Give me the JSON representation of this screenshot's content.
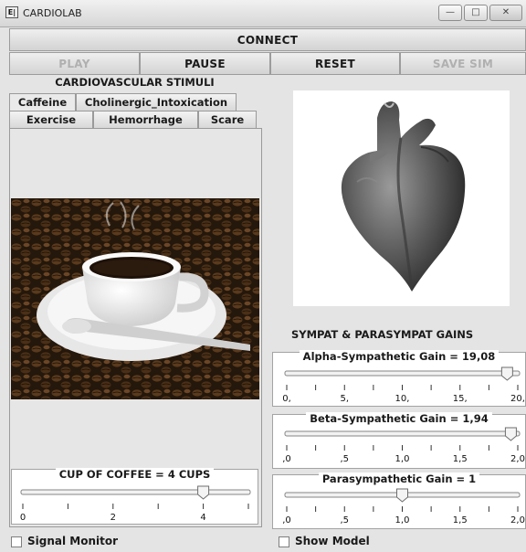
{
  "window": {
    "title": "CARDIOLAB",
    "icon_text": "E|"
  },
  "toolbar": {
    "connect": "CONNECT",
    "play": "PLAY",
    "pause": "PAUSE",
    "reset": "RESET",
    "save_sim": "SAVE SIM"
  },
  "stimuli": {
    "title": "CARDIOVASCULAR STIMULI",
    "tabs": [
      "Caffeine",
      "Cholinergic_Intoxication",
      "Exercise",
      "Hemorrhage",
      "Scare"
    ],
    "active_tab": "Caffeine",
    "coffee_slider": {
      "title": "CUP OF COFFEE = 4 CUPS",
      "min": 0,
      "max": 5,
      "value": 4,
      "labels": [
        "0",
        "2",
        "4"
      ],
      "label_values": [
        0,
        2,
        4
      ],
      "ticks": [
        0,
        1,
        2,
        3,
        4,
        5
      ]
    }
  },
  "gains": {
    "title": "SYMPAT & PARASYMPAT GAINS",
    "alpha": {
      "title": "Alpha-Sympathetic Gain = 19,08",
      "min": 0,
      "max": 20,
      "value": 19.08,
      "labels": [
        "0,",
        "5,",
        "10,",
        "15,",
        "20,"
      ],
      "label_values": [
        0,
        5,
        10,
        15,
        20
      ],
      "ticks": [
        0,
        2.5,
        5,
        7.5,
        10,
        12.5,
        15,
        17.5,
        20
      ]
    },
    "beta": {
      "title": "Beta-Sympathetic Gain = 1,94",
      "min": 0,
      "max": 2,
      "value": 1.94,
      "labels": [
        ",0",
        ",5",
        "1,0",
        "1,5",
        "2,0"
      ],
      "label_values": [
        0,
        0.5,
        1.0,
        1.5,
        2.0
      ],
      "ticks": [
        0,
        0.25,
        0.5,
        0.75,
        1.0,
        1.25,
        1.5,
        1.75,
        2.0
      ]
    },
    "para": {
      "title": "Parasympathetic Gain = 1",
      "min": 0,
      "max": 2,
      "value": 1,
      "labels": [
        ",0",
        ",5",
        "1,0",
        "1,5",
        "2,0"
      ],
      "label_values": [
        0,
        0.5,
        1.0,
        1.5,
        2.0
      ],
      "ticks": [
        0,
        0.25,
        0.5,
        0.75,
        1.0,
        1.25,
        1.5,
        1.75,
        2.0
      ]
    }
  },
  "checkboxes": {
    "signal_monitor": {
      "label": "Signal Monitor",
      "checked": false
    },
    "show_model": {
      "label": "Show Model",
      "checked": false
    }
  },
  "colors": {
    "disabled_text": "#b0b0b0",
    "panel_bg": "#e4e4e4"
  }
}
